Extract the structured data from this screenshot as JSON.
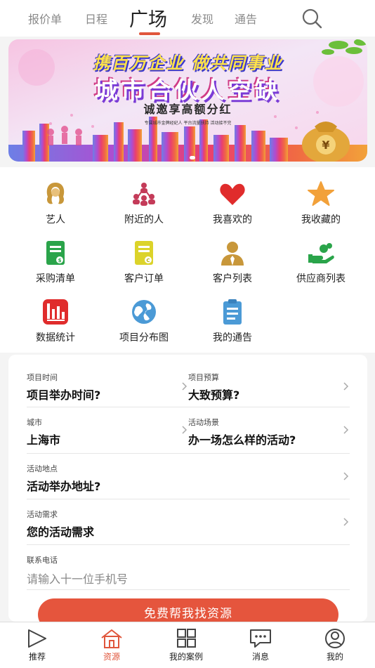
{
  "top_tabs": [
    "报价单",
    "日程",
    "广场",
    "发现",
    "通告"
  ],
  "active_tab": "广场",
  "banner": {
    "title_line1": "携百万企业 做共同事业",
    "title_line2": "城市合伙人空缺",
    "subtitle": "诚邀享高额分红",
    "fine_print": "专属城市金牌经纪人  平台流量扶持  活动接不完"
  },
  "grid": [
    {
      "label": "艺人",
      "icon": "hair-woman-icon"
    },
    {
      "label": "附近的人",
      "icon": "people-network-icon"
    },
    {
      "label": "我喜欢的",
      "icon": "heart-icon"
    },
    {
      "label": "我收藏的",
      "icon": "star-icon"
    },
    {
      "label": "采购清单",
      "icon": "purchase-list-icon"
    },
    {
      "label": "客户订单",
      "icon": "customer-order-icon"
    },
    {
      "label": "客户列表",
      "icon": "customer-person-icon"
    },
    {
      "label": "供应商列表",
      "icon": "supplier-hand-icon"
    },
    {
      "label": "数据统计",
      "icon": "bar-chart-icon"
    },
    {
      "label": "项目分布图",
      "icon": "globe-icon"
    },
    {
      "label": "我的通告",
      "icon": "clipboard-icon"
    }
  ],
  "form": {
    "time_label": "项目时间",
    "time_value": "项目举办时间?",
    "budget_label": "项目预算",
    "budget_value": "大致预算?",
    "city_label": "城市",
    "city_value": "上海市",
    "scene_label": "活动场景",
    "scene_value": "办一场怎么样的活动?",
    "location_label": "活动地点",
    "location_value": "活动举办地址?",
    "need_label": "活动需求",
    "need_value": "您的活动需求",
    "phone_label": "联系电话",
    "phone_placeholder": "请输入十一位手机号"
  },
  "cta_label": "免费帮我找资源",
  "bottom_nav": [
    {
      "label": "推荐",
      "icon": "play-triangle-icon"
    },
    {
      "label": "资源",
      "icon": "home-icon"
    },
    {
      "label": "我的案例",
      "icon": "grid-squares-icon"
    },
    {
      "label": "消息",
      "icon": "chat-bubble-icon"
    },
    {
      "label": "我的",
      "icon": "user-circle-icon"
    }
  ],
  "colors": {
    "accent": "#e0563c",
    "cta": "#e5553d",
    "icon_gold": "#c8973a",
    "icon_red": "#e02c2c",
    "icon_green": "#2aa44a",
    "icon_yellow": "#dcd32a",
    "icon_blue": "#4b9ad6"
  }
}
